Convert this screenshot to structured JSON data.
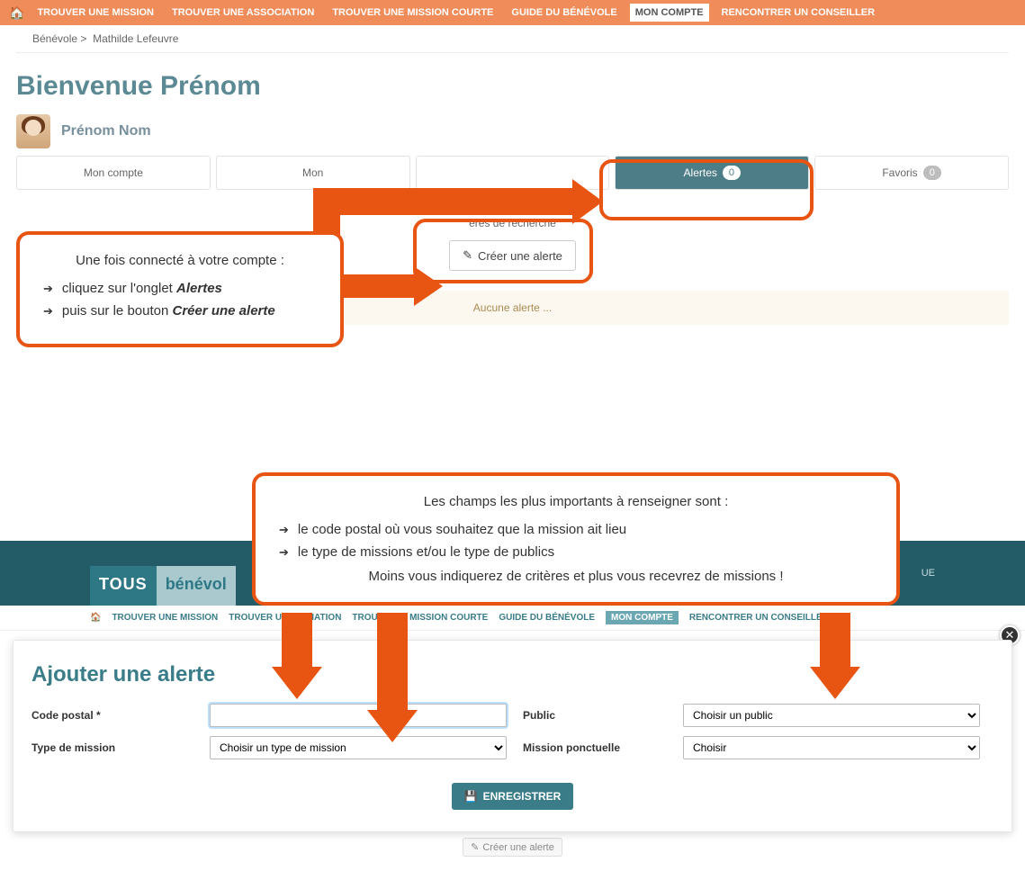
{
  "topnav": {
    "items": [
      "TROUVER UNE MISSION",
      "TROUVER UNE ASSOCIATION",
      "TROUVER UNE MISSION COURTE",
      "GUIDE DU BÉNÉVOLE",
      "MON COMPTE",
      "RENCONTRER UN CONSEILLER"
    ],
    "active_index": 4
  },
  "breadcrumb": {
    "root": "Bénévole",
    "sep": ">",
    "current": "Mathilde Lefeuvre"
  },
  "welcome": "Bienvenue Prénom",
  "user": {
    "name": "Prénom Nom"
  },
  "tabs": {
    "items": [
      {
        "label": "Mon compte",
        "count": null
      },
      {
        "label": "Mon",
        "count": null
      },
      {
        "label": "",
        "count": ""
      },
      {
        "label": "Alertes",
        "count": "0"
      },
      {
        "label": "Favoris",
        "count": "0"
      }
    ],
    "active_index": 3
  },
  "alerts_section": {
    "intro_fragment": "ères de recherche",
    "button": "Créer une alerte",
    "empty": "Aucune alerte ..."
  },
  "callout1": {
    "lead": "Une fois connecté à votre compte :",
    "li1_pre": "cliquez sur l'onglet ",
    "li1_bold": "Alertes",
    "li2_pre": "puis sur le bouton ",
    "li2_bold": "Créer une alerte"
  },
  "callout2": {
    "lead": "Les champs les plus importants à renseigner sont :",
    "li1": "le code postal où vous souhaitez que la mission ait lieu",
    "li2": "le type de missions et/ou le type de publics",
    "footer": "Moins vous indiquerez de critères et plus vous recevrez de missions !"
  },
  "section2": {
    "logo": {
      "part1": "TOUS",
      "part2": "bénévol"
    },
    "right_link": "UE",
    "nav": {
      "items": [
        "TROUVER UNE MISSION",
        "TROUVER UNE",
        "CIATION",
        "TROUV",
        "NE MISSION COURTE",
        "GUIDE DU BÉNÉVOLE",
        "MON COMPTE",
        "RENCONTRER UN CONSEILLER"
      ],
      "active_index": 6
    }
  },
  "modal": {
    "title": "Ajouter une alerte",
    "labels": {
      "postal": "Code postal",
      "type": "Type de mission",
      "public": "Public",
      "ponctuelle": "Mission ponctuelle"
    },
    "selects": {
      "type": "Choisir un type de mission",
      "public": "Choisir un public",
      "ponctuelle": "Choisir"
    },
    "save": "ENREGISTRER",
    "ghost": "Créer une alerte"
  }
}
